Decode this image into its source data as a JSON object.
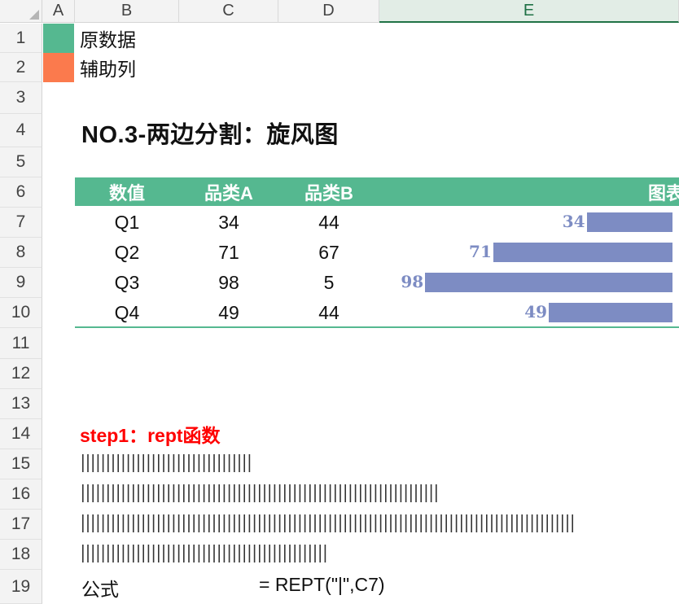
{
  "columns": [
    "A",
    "B",
    "C",
    "D",
    "E"
  ],
  "rows": [
    "1",
    "2",
    "3",
    "4",
    "5",
    "6",
    "7",
    "8",
    "9",
    "10",
    "11",
    "12",
    "13",
    "14",
    "15",
    "16",
    "17",
    "18",
    "19"
  ],
  "legend": [
    {
      "label": "原数据",
      "color": "#55b890"
    },
    {
      "label": "辅助列",
      "color": "#fb7a4d"
    }
  ],
  "title": "NO.3-两边分割：旋风图",
  "table": {
    "headers": [
      "数值",
      "品类A",
      "品类B",
      "图表"
    ],
    "rows": [
      {
        "q": "Q1",
        "a": "34",
        "b": "44"
      },
      {
        "q": "Q2",
        "a": "71",
        "b": "67"
      },
      {
        "q": "Q3",
        "a": "98",
        "b": "5"
      },
      {
        "q": "Q4",
        "a": "49",
        "b": "44"
      }
    ]
  },
  "chart_data": {
    "type": "bar",
    "categories": [
      "Q1",
      "Q2",
      "Q3",
      "Q4"
    ],
    "values": [
      34,
      71,
      98,
      49
    ],
    "bar_color": "#7d8cc3"
  },
  "step": "step1：rept函数",
  "rept_counts": [
    34,
    71,
    98,
    49
  ],
  "formula": {
    "label": "公式",
    "text": "= REPT(\"|\",C7)"
  }
}
